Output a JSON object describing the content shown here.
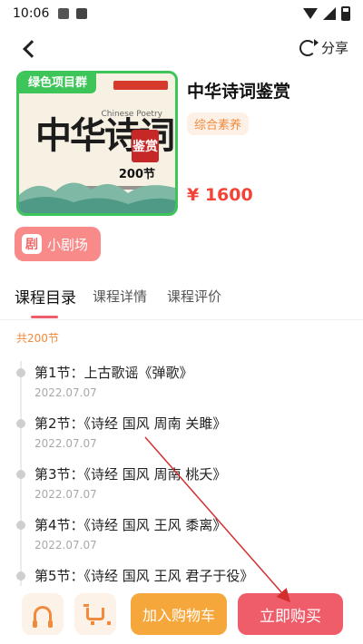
{
  "status_bar": {
    "time": "10:06"
  },
  "nav": {
    "share_label": "分享"
  },
  "cover": {
    "group_tag": "绿色项目群",
    "big_title": "中华诗词",
    "sub_en": "Chinese Poetry",
    "seal": "鉴赏",
    "count": "200节"
  },
  "course": {
    "title": "中华诗词鉴赏",
    "tag": "综合素养",
    "price": "¥ 1600"
  },
  "theater": {
    "icon_char": "剧",
    "label": "小剧场"
  },
  "tabs": [
    {
      "label": "课程目录"
    },
    {
      "label": "课程详情"
    },
    {
      "label": "课程评价"
    }
  ],
  "lesson_count": "共200节",
  "lessons": [
    {
      "title": "第1节：上古歌谣《弹歌》",
      "date": "2022.07.07"
    },
    {
      "title": "第2节：《诗经 国风 周南 关雎》",
      "date": "2022.07.07"
    },
    {
      "title": "第3节：《诗经 国风 周南 桃夭》",
      "date": "2022.07.07"
    },
    {
      "title": "第4节：《诗经 国风 王风 黍离》",
      "date": "2022.07.07"
    },
    {
      "title": "第5节：《诗经 国风 王风 君子于役》",
      "date": ""
    }
  ],
  "bottom_bar": {
    "add_cart_label": "加入购物车",
    "buy_now_label": "立即购买"
  },
  "colors": {
    "accent_red": "#f05d6a",
    "accent_orange": "#f6a73b",
    "cover_green": "#3ec55a",
    "arrow": "#d32f2f"
  },
  "icons": [
    "back-icon",
    "share-icon",
    "headset-icon",
    "cart-icon",
    "theater-icon"
  ]
}
